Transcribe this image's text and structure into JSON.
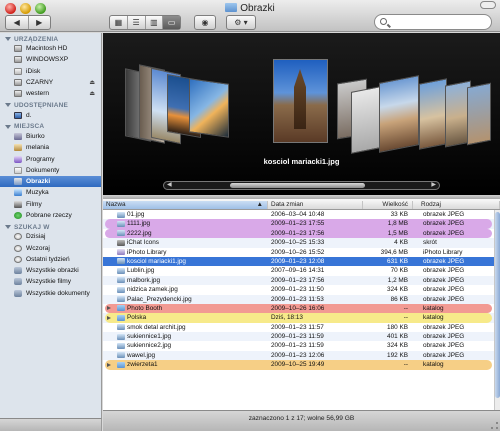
{
  "window": {
    "title": "Obrazki"
  },
  "toolbar": {
    "back_icon": "◀",
    "forward_icon": "▶",
    "view_icons": [
      "▦",
      "☰",
      "▥",
      "▭"
    ],
    "eye_icon": "◉",
    "gear_icon": "⚙ ▾"
  },
  "sidebar": {
    "sections": [
      {
        "title": "URZĄDZENIA",
        "items": [
          {
            "label": "Macintosh HD",
            "icon": "hd"
          },
          {
            "label": "WINDOWSXP",
            "icon": "hd"
          },
          {
            "label": "iDisk",
            "icon": "idisk"
          },
          {
            "label": "CZARNY",
            "icon": "hd",
            "eject": true
          },
          {
            "label": "western",
            "icon": "hd",
            "eject": true
          }
        ]
      },
      {
        "title": "UDOSTĘPNIANE",
        "items": [
          {
            "label": "d.",
            "icon": "mon"
          }
        ]
      },
      {
        "title": "MIEJSCA",
        "items": [
          {
            "label": "Biurko",
            "icon": "desk"
          },
          {
            "label": "melania",
            "icon": "home"
          },
          {
            "label": "Programy",
            "icon": "app"
          },
          {
            "label": "Dokumenty",
            "icon": "doc"
          },
          {
            "label": "Obrazki",
            "icon": "pic",
            "selected": true
          },
          {
            "label": "Muzyka",
            "icon": "mus"
          },
          {
            "label": "Filmy",
            "icon": "film"
          },
          {
            "label": "Pobrane rzeczy",
            "icon": "dl"
          }
        ]
      },
      {
        "title": "SZUKAJ W",
        "items": [
          {
            "label": "Dzisiaj",
            "icon": "clock"
          },
          {
            "label": "Wczoraj",
            "icon": "clock"
          },
          {
            "label": "Ostatni tydzień",
            "icon": "clock"
          },
          {
            "label": "Wszystkie obrazki",
            "icon": "smart"
          },
          {
            "label": "Wszystkie filmy",
            "icon": "smart"
          },
          {
            "label": "Wszystkie dokumenty",
            "icon": "smart"
          }
        ]
      }
    ]
  },
  "coverflow": {
    "caption": "kosciol mariacki1.jpg",
    "left_arrow": "◀",
    "right_arrow": "▶"
  },
  "list": {
    "columns": {
      "name": "Nazwa",
      "date": "Data zmian",
      "size": "Wielkość",
      "kind": "Rodzaj",
      "sort_icon": "▲"
    },
    "rows": [
      {
        "name": "01.jpg",
        "date": "2006–03–04 10:48",
        "size": "33 KB",
        "kind": "obrazek JPEG",
        "icon": "jpg"
      },
      {
        "name": "1111.jpg",
        "date": "2009–01–23 17:55",
        "size": "1,8 MB",
        "kind": "obrazek JPEG",
        "icon": "jpg",
        "label": "#d9a9e8"
      },
      {
        "name": "2222.jpg",
        "date": "2009–01–23 17:56",
        "size": "1,5 MB",
        "kind": "obrazek JPEG",
        "icon": "jpg",
        "label": "#d9a9e8"
      },
      {
        "name": "iChat Icons",
        "date": "2009–10–25 15:33",
        "size": "4 KB",
        "kind": "skrót",
        "icon": "ic"
      },
      {
        "name": "iPhoto Library",
        "date": "2009–10–26 15:52",
        "size": "394,6 MB",
        "kind": "iPhoto Library",
        "icon": "lib"
      },
      {
        "name": "kosciol mariacki1.jpg",
        "date": "2009–01–23 12:08",
        "size": "631 KB",
        "kind": "obrazek JPEG",
        "icon": "jpg",
        "selected": true
      },
      {
        "name": "Lublin.jpg",
        "date": "2007–09–16 14:31",
        "size": "70 KB",
        "kind": "obrazek JPEG",
        "icon": "jpg"
      },
      {
        "name": "malbork.jpg",
        "date": "2009–01–23 17:56",
        "size": "1,2 MB",
        "kind": "obrazek JPEG",
        "icon": "jpg"
      },
      {
        "name": "nidzica zamek.jpg",
        "date": "2009–01–23 11:50",
        "size": "324 KB",
        "kind": "obrazek JPEG",
        "icon": "jpg"
      },
      {
        "name": "Palac_Prezydencki.jpg",
        "date": "2009–01–23 11:53",
        "size": "86 KB",
        "kind": "obrazek JPEG",
        "icon": "jpg"
      },
      {
        "name": "Photo Booth",
        "date": "2009–10–26 16:06",
        "size": "--",
        "kind": "katalog",
        "icon": "fold",
        "label": "#f29a93",
        "folder": true
      },
      {
        "name": "Polska",
        "date": "Dziś, 18:13",
        "size": "--",
        "kind": "katalog",
        "icon": "fold",
        "label": "#f7ea8a",
        "folder": true
      },
      {
        "name": "smok detal archit.jpg",
        "date": "2009–01–23 11:57",
        "size": "180 KB",
        "kind": "obrazek JPEG",
        "icon": "jpg"
      },
      {
        "name": "sukiennice1.jpg",
        "date": "2009–01–23 11:59",
        "size": "401 KB",
        "kind": "obrazek JPEG",
        "icon": "jpg"
      },
      {
        "name": "sukiennice2.jpg",
        "date": "2009–01–23 11:59",
        "size": "324 KB",
        "kind": "obrazek JPEG",
        "icon": "jpg"
      },
      {
        "name": "wawel.jpg",
        "date": "2009–01–23 12:06",
        "size": "192 KB",
        "kind": "obrazek JPEG",
        "icon": "jpg"
      },
      {
        "name": "zwierzeta1",
        "date": "2009–10–25 19:49",
        "size": "--",
        "kind": "katalog",
        "icon": "fold",
        "label": "#f6cf86",
        "folder": true
      }
    ]
  },
  "status": {
    "text": "zaznaczono 1 z 17; wolne 56,99 GB"
  }
}
